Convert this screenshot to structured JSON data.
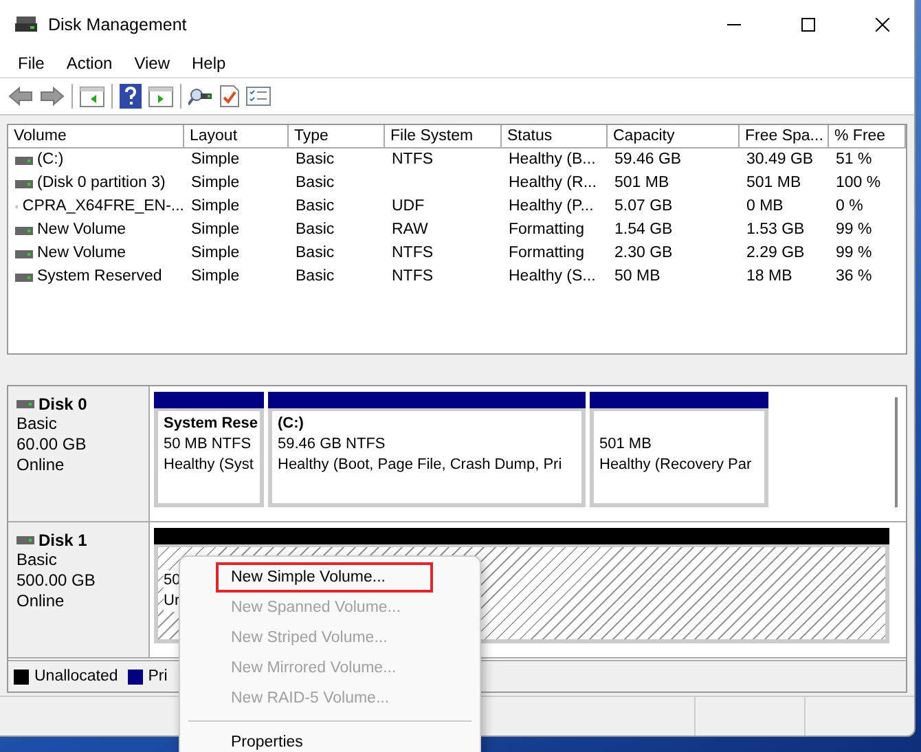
{
  "window": {
    "title": "Disk Management"
  },
  "menu_bar": [
    "File",
    "Action",
    "View",
    "Help"
  ],
  "volume_table": {
    "columns": [
      "Volume",
      "Layout",
      "Type",
      "File System",
      "Status",
      "Capacity",
      "Free Spa...",
      "% Free"
    ],
    "rows": [
      {
        "kind": "disk",
        "cells": [
          "(C:)",
          "Simple",
          "Basic",
          "NTFS",
          "Healthy (B...",
          "59.46 GB",
          "30.49 GB",
          "51 %"
        ]
      },
      {
        "kind": "disk",
        "cells": [
          "(Disk 0 partition 3)",
          "Simple",
          "Basic",
          "",
          "Healthy (R...",
          "501 MB",
          "501 MB",
          "100 %"
        ]
      },
      {
        "kind": "cd",
        "cells": [
          "CPRA_X64FRE_EN-...",
          "Simple",
          "Basic",
          "UDF",
          "Healthy (P...",
          "5.07 GB",
          "0 MB",
          "0 %"
        ]
      },
      {
        "kind": "disk",
        "cells": [
          "New Volume",
          "Simple",
          "Basic",
          "RAW",
          "Formatting",
          "1.54 GB",
          "1.53 GB",
          "99 %"
        ]
      },
      {
        "kind": "disk",
        "cells": [
          "New Volume",
          "Simple",
          "Basic",
          "NTFS",
          "Formatting",
          "2.30 GB",
          "2.29 GB",
          "99 %"
        ]
      },
      {
        "kind": "disk",
        "cells": [
          "System Reserved",
          "Simple",
          "Basic",
          "NTFS",
          "Healthy (S...",
          "50 MB",
          "18 MB",
          "36 %"
        ]
      }
    ]
  },
  "disks": [
    {
      "name": "Disk 0",
      "type": "Basic",
      "size": "60.00 GB",
      "status": "Online",
      "partitions": [
        {
          "kind": "primary",
          "color": "#000080",
          "title": "System Rese",
          "lines": [
            "50 MB NTFS",
            "Healthy (Syst"
          ]
        },
        {
          "kind": "primary",
          "color": "#000080",
          "title": "(C:)",
          "lines": [
            "59.46 GB NTFS",
            "Healthy (Boot, Page File, Crash Dump, Pri"
          ]
        },
        {
          "kind": "primary",
          "color": "#000080",
          "lines": [
            "501 MB",
            "Healthy (Recovery Par"
          ]
        }
      ]
    },
    {
      "name": "Disk 1",
      "type": "Basic",
      "size": "500.00 GB",
      "status": "Online",
      "partitions": [
        {
          "kind": "unallocated",
          "color": "#000000",
          "lines": [
            "50",
            "Ur"
          ]
        }
      ]
    }
  ],
  "legend": [
    {
      "label": "Unallocated",
      "color": "#000000"
    },
    {
      "label": "Pri",
      "color": "#000080"
    }
  ],
  "context_menu": [
    {
      "kind": "item",
      "label": "New Simple Volume...",
      "disabled": false,
      "selected": true
    },
    {
      "kind": "item",
      "label": "New Spanned Volume...",
      "disabled": true,
      "selected": false
    },
    {
      "kind": "item",
      "label": "New Striped Volume...",
      "disabled": true,
      "selected": false
    },
    {
      "kind": "item",
      "label": "New Mirrored Volume...",
      "disabled": true,
      "selected": false
    },
    {
      "kind": "item",
      "label": "New RAID-5 Volume...",
      "disabled": true,
      "selected": false
    },
    {
      "kind": "separator"
    },
    {
      "kind": "item",
      "label": "Properties",
      "disabled": false,
      "selected": false
    }
  ]
}
